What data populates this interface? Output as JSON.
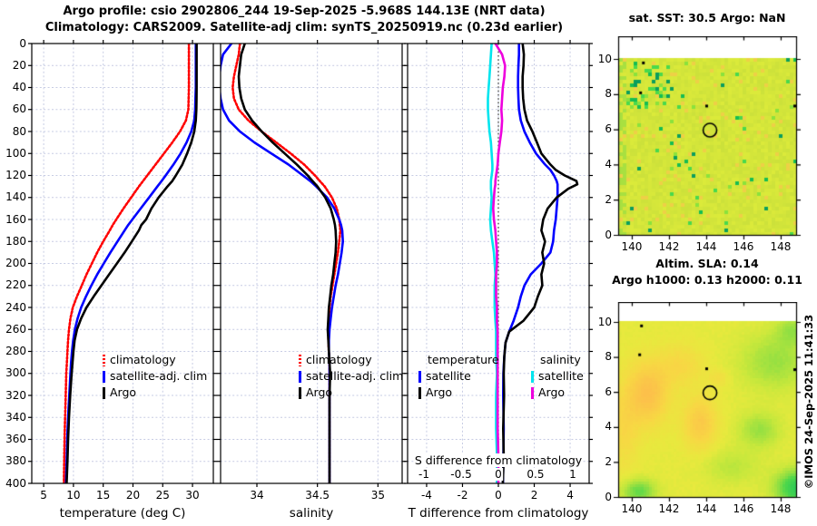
{
  "header": {
    "title1": "Argo profile: csio 2902806_244 19-Sep-2025 -5.968S 144.13E (NRT data)",
    "title2": "Climatology: CARS2009. Satellite-adj clim: synTS_20250919.nc (0.23d earlier)"
  },
  "watermark": "©IMOS 24-Sep-2025 11:41:33",
  "colors": {
    "climatology": "#ff0000",
    "satellite_adj": "#0000ff",
    "argo": "#000000",
    "sal_satellite": "#00e5ee",
    "sal_argo": "#ee00dd",
    "grid": "#c7cce4"
  },
  "chart_data": [
    {
      "type": "line",
      "panel": "temperature-profile",
      "xlabel": "temperature (deg C)",
      "xlim": [
        3.0,
        33.5
      ],
      "xticks": [
        5,
        10,
        15,
        20,
        25,
        30
      ],
      "ylim": [
        0,
        400
      ],
      "ystep": 20,
      "depths": [
        0,
        10,
        20,
        30,
        40,
        50,
        60,
        70,
        80,
        90,
        100,
        110,
        120,
        125,
        130,
        140,
        150,
        160,
        165,
        170,
        180,
        190,
        200,
        210,
        220,
        230,
        240,
        250,
        260,
        270,
        280,
        290,
        300,
        320,
        340,
        360,
        380,
        400
      ],
      "series": [
        {
          "name": "climatology",
          "color": "#ff0000",
          "style": "dotted",
          "values": [
            29.4,
            29.4,
            29.4,
            29.4,
            29.4,
            29.35,
            29.3,
            28.9,
            27.9,
            26.6,
            25.2,
            23.8,
            22.4,
            21.7,
            21.0,
            19.7,
            18.4,
            17.2,
            16.6,
            16.1,
            15.0,
            14.0,
            13.1,
            12.2,
            11.4,
            10.6,
            9.9,
            9.5,
            9.25,
            9.1,
            9.0,
            8.9,
            8.8,
            8.7,
            8.6,
            8.5,
            8.45,
            8.4
          ]
        },
        {
          "name": "satellite-adj. clim",
          "color": "#0000ff",
          "style": "solid",
          "values": [
            30.55,
            30.55,
            30.55,
            30.55,
            30.55,
            30.5,
            30.45,
            30.3,
            29.8,
            29.0,
            28.0,
            26.8,
            25.5,
            24.8,
            24.1,
            22.7,
            21.3,
            19.9,
            19.2,
            18.6,
            17.4,
            16.2,
            15.1,
            14.0,
            13.0,
            12.1,
            11.3,
            10.7,
            10.25,
            9.95,
            9.75,
            9.6,
            9.5,
            9.3,
            9.1,
            8.95,
            8.85,
            8.75
          ]
        },
        {
          "name": "Argo",
          "color": "#000000",
          "style": "solid",
          "values": [
            30.7,
            30.7,
            30.7,
            30.7,
            30.7,
            30.68,
            30.65,
            30.55,
            30.3,
            29.8,
            29.1,
            28.3,
            27.2,
            26.6,
            25.8,
            24.3,
            23.1,
            22.2,
            21.4,
            21.0,
            19.8,
            18.6,
            17.3,
            16.0,
            14.7,
            13.4,
            12.2,
            11.3,
            10.6,
            10.2,
            10.0,
            9.85,
            9.7,
            9.45,
            9.25,
            9.1,
            9.0,
            8.85
          ]
        }
      ],
      "legend": [
        {
          "label": "climatology",
          "color": "#ff0000",
          "style": "dotted"
        },
        {
          "label": "satellite-adj. clim",
          "color": "#0000ff",
          "style": "solid"
        },
        {
          "label": "Argo",
          "color": "#000000",
          "style": "solid"
        }
      ]
    },
    {
      "type": "line",
      "panel": "salinity-profile",
      "xlabel": "salinity",
      "xlim": [
        33.7,
        35.2
      ],
      "xticks": [
        34,
        34.5,
        35
      ],
      "ylim": [
        0,
        400
      ],
      "ystep": 20,
      "depths": [
        0,
        10,
        20,
        30,
        40,
        50,
        60,
        70,
        80,
        90,
        100,
        110,
        120,
        125,
        130,
        140,
        150,
        160,
        165,
        170,
        180,
        190,
        200,
        210,
        220,
        230,
        240,
        250,
        260,
        270,
        280,
        290,
        300,
        320,
        340,
        360,
        380,
        400
      ],
      "series": [
        {
          "name": "climatology",
          "color": "#ff0000",
          "style": "dotted",
          "values": [
            33.86,
            33.85,
            33.83,
            33.81,
            33.8,
            33.81,
            33.85,
            33.93,
            34.04,
            34.16,
            34.28,
            34.39,
            34.48,
            34.52,
            34.56,
            34.62,
            34.66,
            34.68,
            34.685,
            34.69,
            34.68,
            34.67,
            34.655,
            34.64,
            34.625,
            34.61,
            34.6,
            34.595,
            34.59,
            34.59,
            34.595,
            34.6,
            34.6,
            34.6,
            34.6,
            34.6,
            34.6,
            34.6
          ]
        },
        {
          "name": "satellite-adj. clim",
          "color": "#0000ff",
          "style": "solid",
          "values": [
            33.79,
            33.72,
            33.7,
            33.69,
            33.69,
            33.7,
            33.72,
            33.77,
            33.86,
            33.98,
            34.12,
            34.26,
            34.38,
            34.44,
            34.49,
            34.58,
            34.64,
            34.68,
            34.695,
            34.705,
            34.71,
            34.7,
            34.685,
            34.67,
            34.65,
            34.635,
            34.62,
            34.61,
            34.6,
            34.595,
            34.595,
            34.6,
            34.6,
            34.6,
            34.6,
            34.6,
            34.6,
            34.6
          ]
        },
        {
          "name": "Argo",
          "color": "#000000",
          "style": "solid",
          "values": [
            33.9,
            33.87,
            33.86,
            33.85,
            33.855,
            33.87,
            33.9,
            33.96,
            34.04,
            34.13,
            34.23,
            34.33,
            34.42,
            34.46,
            34.5,
            34.565,
            34.61,
            34.635,
            34.645,
            34.65,
            34.655,
            34.65,
            34.64,
            34.63,
            34.615,
            34.605,
            34.595,
            34.59,
            34.585,
            34.59,
            34.595,
            34.6,
            34.605,
            34.6,
            34.6,
            34.6,
            34.6,
            34.6
          ]
        }
      ],
      "legend": [
        {
          "label": "climatology",
          "color": "#ff0000",
          "style": "dotted"
        },
        {
          "label": "satellite-adj. clim",
          "color": "#0000ff",
          "style": "solid"
        },
        {
          "label": "Argo",
          "color": "#000000",
          "style": "solid"
        }
      ]
    },
    {
      "type": "line",
      "panel": "difference-profile",
      "xlabel": "T difference from climatology",
      "xlim": [
        -5.06,
        5.06
      ],
      "xticks": [
        -4,
        -2,
        0,
        2,
        4
      ],
      "ylim": [
        0,
        400
      ],
      "ystep": 20,
      "zero_line": true,
      "s_axis": {
        "label": "S difference from climatology",
        "xlim": [
          -1.22,
          1.22
        ],
        "ticks": [
          -1,
          -0.5,
          0,
          0.5,
          1
        ]
      },
      "depths": [
        0,
        10,
        20,
        30,
        40,
        50,
        60,
        70,
        80,
        90,
        100,
        110,
        115,
        120,
        125,
        128,
        132,
        140,
        150,
        160,
        170,
        180,
        190,
        200,
        210,
        220,
        230,
        240,
        252,
        262,
        272,
        285,
        300,
        320,
        350,
        375,
        400
      ],
      "series": [
        {
          "name": "S satellite",
          "axis": "S",
          "color": "#00e5ee",
          "style": "solid",
          "values": [
            -0.09,
            -0.1,
            -0.11,
            -0.12,
            -0.13,
            -0.14,
            -0.14,
            -0.13,
            -0.12,
            -0.1,
            -0.09,
            -0.08,
            -0.08,
            -0.09,
            -0.1,
            -0.1,
            -0.1,
            -0.09,
            -0.1,
            -0.11,
            -0.1,
            -0.08,
            -0.06,
            -0.05,
            -0.04,
            -0.05,
            -0.05,
            -0.05,
            -0.04,
            -0.03,
            -0.03,
            -0.03,
            -0.02,
            -0.03,
            -0.03,
            -0.02,
            -0.02
          ]
        },
        {
          "name": "S Argo",
          "axis": "S",
          "color": "#ee00dd",
          "style": "solid",
          "values": [
            -0.04,
            0.05,
            0.09,
            0.08,
            0.06,
            0.05,
            0.04,
            0.05,
            0.04,
            0.02,
            0.0,
            -0.01,
            -0.02,
            -0.03,
            -0.04,
            -0.04,
            -0.05,
            -0.06,
            -0.07,
            -0.06,
            -0.04,
            -0.03,
            -0.02,
            -0.02,
            -0.03,
            -0.03,
            -0.03,
            -0.02,
            -0.02,
            -0.01,
            -0.01,
            -0.01,
            -0.01,
            -0.01,
            -0.01,
            0.0,
            0.0
          ]
        },
        {
          "name": "T satellite",
          "axis": "T",
          "color": "#0000ff",
          "style": "solid",
          "values": [
            1.15,
            1.15,
            1.12,
            1.1,
            1.1,
            1.12,
            1.15,
            1.25,
            1.45,
            1.75,
            2.1,
            2.6,
            2.9,
            3.1,
            3.25,
            3.3,
            3.3,
            3.3,
            3.25,
            3.2,
            3.1,
            3.05,
            2.9,
            2.4,
            1.8,
            1.45,
            1.25,
            1.1,
            0.85,
            0.6,
            0.4,
            0.33,
            0.28,
            0.27,
            0.3,
            0.28,
            0.26
          ]
        },
        {
          "name": "T Argo",
          "axis": "T",
          "color": "#000000",
          "style": "solid",
          "values": [
            1.35,
            1.42,
            1.4,
            1.35,
            1.35,
            1.38,
            1.45,
            1.6,
            1.9,
            2.15,
            2.4,
            2.9,
            3.2,
            3.7,
            4.35,
            4.4,
            3.9,
            3.25,
            2.75,
            2.5,
            2.4,
            2.6,
            2.45,
            2.55,
            2.4,
            2.45,
            2.2,
            2.0,
            1.4,
            0.6,
            0.4,
            0.33,
            0.3,
            0.32,
            0.27,
            0.3,
            0.25
          ]
        }
      ],
      "legend_cols": [
        {
          "header": "temperature",
          "entries": [
            {
              "label": "satellite",
              "color": "#0000ff"
            },
            {
              "label": "Argo",
              "color": "#000000"
            }
          ]
        },
        {
          "header": "salinity",
          "entries": [
            {
              "label": "satellite",
              "color": "#00e5ee"
            },
            {
              "label": "Argo",
              "color": "#ee00dd"
            }
          ]
        }
      ]
    },
    {
      "type": "heatmap",
      "panel": "sst-map",
      "title": "sat. SST: 30.5 Argo: NaN",
      "xticks": [
        140,
        142,
        144,
        146,
        148
      ],
      "yticks": [
        0,
        2,
        4,
        6,
        8,
        10
      ],
      "lat_extent": [
        0,
        10.05
      ],
      "style": "speckled",
      "palette": {
        "base": "#d4e63a",
        "warm": "#eed046",
        "greens": [
          "#8ae23c",
          "#49d94c",
          "#16bd52",
          "#0b9e5d"
        ],
        "left_green": "#a8e040"
      },
      "cluster_region": [
        139.3,
        141.9,
        7.2,
        10.05
      ],
      "float_circle": {
        "lon": 144.2,
        "lat": 5.95
      },
      "track_dots": [
        [
          140.6,
          9.8
        ],
        [
          140.45,
          8.1
        ],
        [
          144.0,
          7.35
        ],
        [
          149.25,
          7.35
        ]
      ]
    },
    {
      "type": "heatmap",
      "panel": "sla-map",
      "title1": "Altim. SLA: 0.14",
      "title2": "Argo h1000: 0.13 h2000: 0.11",
      "xticks": [
        140,
        142,
        144,
        146,
        148
      ],
      "yticks": [
        0,
        2,
        4,
        6,
        8,
        10
      ],
      "lat_extent": [
        0,
        10.05
      ],
      "style": "smooth",
      "stops": [
        [
          -1.3,
          "#28c85a"
        ],
        [
          -0.8,
          "#50d84b"
        ],
        [
          -0.45,
          "#96e042"
        ],
        [
          -0.15,
          "#c8e83c"
        ],
        [
          0.1,
          "#e8ea3e"
        ],
        [
          0.45,
          "#f8d844"
        ],
        [
          0.8,
          "#fcc34a"
        ],
        [
          1.2,
          "#ffb050"
        ]
      ],
      "field_blobs": [
        [
          140.8,
          6.0,
          1.1,
          1.8,
          0.75
        ],
        [
          143.6,
          4.3,
          0.9,
          1.5,
          0.6
        ],
        [
          142.6,
          7.6,
          1.2,
          1.2,
          0.35
        ],
        [
          139.5,
          4.0,
          0.8,
          2.5,
          0.35
        ],
        [
          144.6,
          6.9,
          0.5,
          0.5,
          0.25
        ],
        [
          148.9,
          0.6,
          1.2,
          1.0,
          -1.3
        ],
        [
          140.3,
          0.4,
          0.9,
          0.7,
          -0.8
        ],
        [
          146.8,
          3.9,
          1.1,
          1.0,
          -0.5
        ],
        [
          147.6,
          7.8,
          1.8,
          1.6,
          -0.5
        ],
        [
          145.3,
          1.8,
          1.5,
          1.0,
          -0.3
        ],
        [
          148.6,
          9.6,
          0.9,
          0.8,
          -0.45
        ]
      ],
      "float_circle": {
        "lon": 144.2,
        "lat": 5.95
      },
      "track_dots": [
        [
          140.5,
          9.8
        ],
        [
          140.4,
          8.15
        ],
        [
          144.0,
          7.35
        ],
        [
          149.25,
          7.3
        ]
      ]
    }
  ]
}
